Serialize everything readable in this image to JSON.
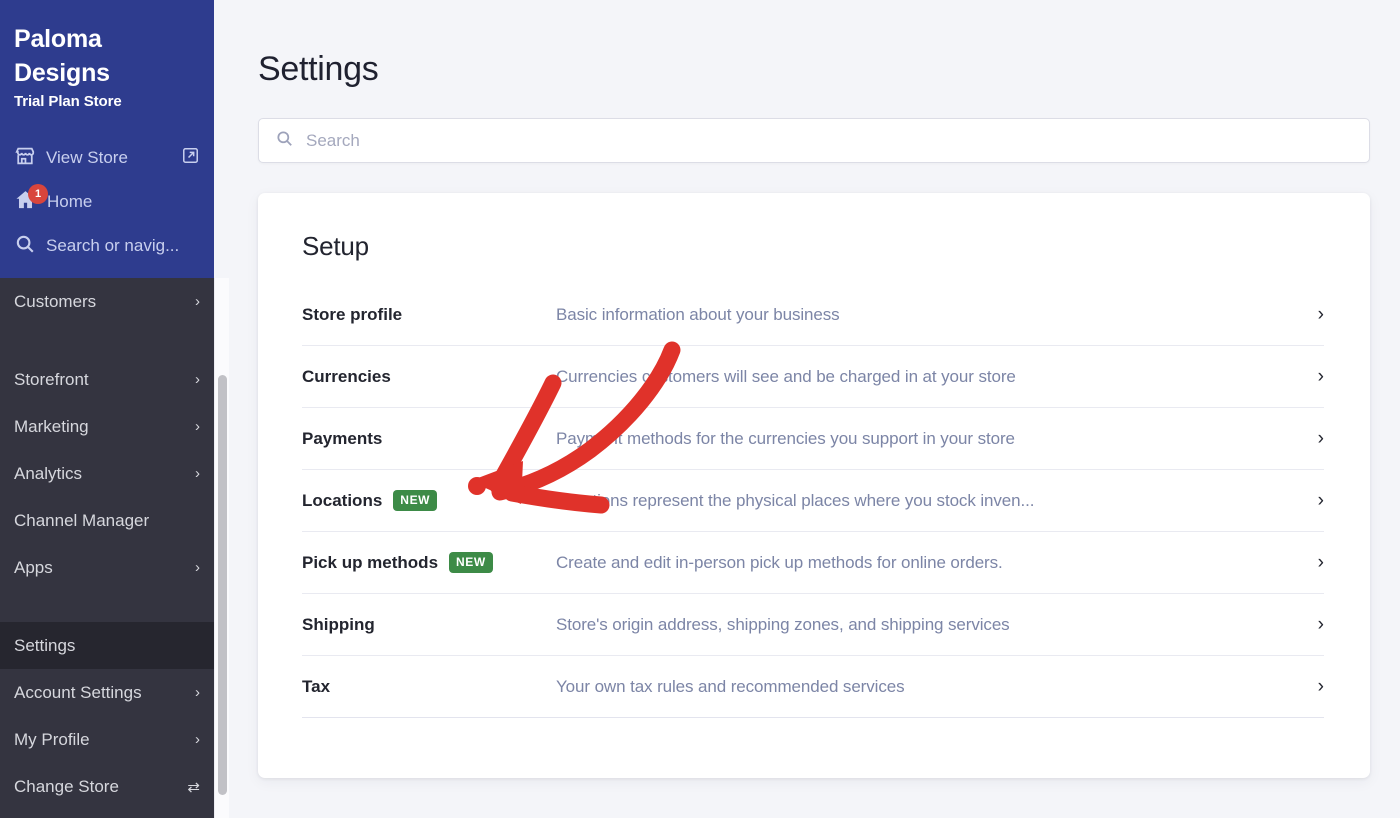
{
  "sidebar": {
    "store_name": "Paloma Designs",
    "store_plan": "Trial Plan Store",
    "links": [
      {
        "label": "View Store",
        "icon": "storefront-icon",
        "trailing_icon": "external-link-icon"
      },
      {
        "label": "Home",
        "icon": "home-icon",
        "badge": "1"
      },
      {
        "label": "Search or navig...",
        "icon": "search-icon"
      }
    ],
    "nav": [
      {
        "label": "Customers",
        "chevron": "›",
        "active": false
      },
      {
        "label": "Storefront",
        "chevron": "›",
        "active": false
      },
      {
        "label": "Marketing",
        "chevron": "›",
        "active": false
      },
      {
        "label": "Analytics",
        "chevron": "›",
        "active": false
      },
      {
        "label": "Channel Manager",
        "chevron": "",
        "active": false
      },
      {
        "label": "Apps",
        "chevron": "›",
        "active": false
      },
      {
        "label": "Settings",
        "chevron": "",
        "active": true
      },
      {
        "label": "Account Settings",
        "chevron": "›",
        "active": false
      },
      {
        "label": "My Profile",
        "chevron": "›",
        "active": false
      },
      {
        "label": "Change Store",
        "chevron": "⇄",
        "active": false
      }
    ]
  },
  "main": {
    "page_title": "Settings",
    "search": {
      "value": "",
      "placeholder": "Search",
      "icon": "search-icon"
    },
    "card": {
      "heading": "Setup",
      "rows": [
        {
          "label": "Store profile",
          "badge": "",
          "desc": "Basic information about your business",
          "chevron": "›"
        },
        {
          "label": "Currencies",
          "badge": "",
          "desc": "Currencies customers will see and be charged in at your store",
          "chevron": "›"
        },
        {
          "label": "Payments",
          "badge": "",
          "desc": "Payment methods for the currencies you support in your store",
          "chevron": "›"
        },
        {
          "label": "Locations",
          "badge": "NEW",
          "desc": "Locations represent the physical places where you stock inven...",
          "chevron": "›"
        },
        {
          "label": "Pick up methods",
          "badge": "NEW",
          "desc": "Create and edit in-person pick up methods for online orders.",
          "chevron": "›"
        },
        {
          "label": "Shipping",
          "badge": "",
          "desc": "Store's origin address, shipping zones, and shipping services",
          "chevron": "›"
        },
        {
          "label": "Tax",
          "badge": "",
          "desc": "Your own tax rules and recommended services",
          "chevron": "›"
        }
      ]
    }
  },
  "annotation": {
    "type": "arrow",
    "color": "#e0322a",
    "points_to": "Payments",
    "description": "Hand-drawn red curved arrow pointing left at the Payments row"
  },
  "colors": {
    "sidebar_top": "#2e3c8e",
    "sidebar_bottom": "#343440",
    "sidebar_active": "#26262f",
    "page_bg": "#f4f5f9",
    "card_bg": "#ffffff",
    "badge_new": "#3d8b47",
    "badge_alert": "#d9453c",
    "annotation_red": "#e0322a",
    "desc_text": "#7c85a6"
  }
}
